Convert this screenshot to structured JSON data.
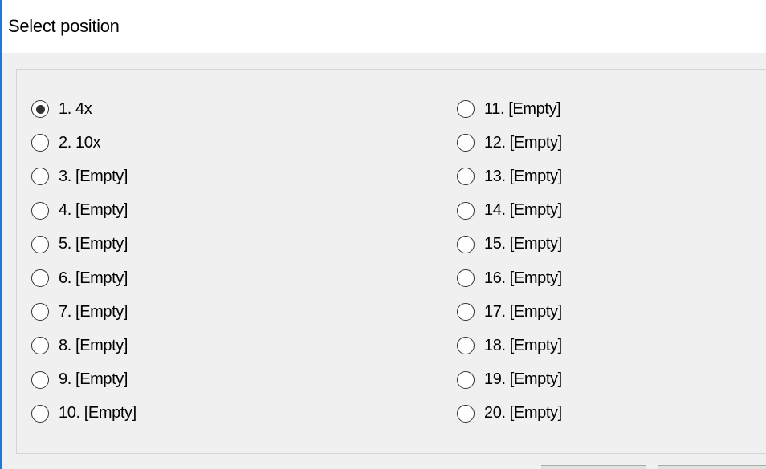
{
  "window": {
    "title": "Select position"
  },
  "positions": {
    "left": [
      {
        "label": "1. 4x",
        "checked": true
      },
      {
        "label": "2. 10x",
        "checked": false
      },
      {
        "label": "3. [Empty]",
        "checked": false
      },
      {
        "label": "4. [Empty]",
        "checked": false
      },
      {
        "label": "5. [Empty]",
        "checked": false
      },
      {
        "label": "6. [Empty]",
        "checked": false
      },
      {
        "label": "7. [Empty]",
        "checked": false
      },
      {
        "label": "8. [Empty]",
        "checked": false
      },
      {
        "label": "9. [Empty]",
        "checked": false
      },
      {
        "label": "10. [Empty]",
        "checked": false
      }
    ],
    "right": [
      {
        "label": "11. [Empty]",
        "checked": false
      },
      {
        "label": "12. [Empty]",
        "checked": false
      },
      {
        "label": "13. [Empty]",
        "checked": false
      },
      {
        "label": "14. [Empty]",
        "checked": false
      },
      {
        "label": "15. [Empty]",
        "checked": false
      },
      {
        "label": "16. [Empty]",
        "checked": false
      },
      {
        "label": "17. [Empty]",
        "checked": false
      },
      {
        "label": "18. [Empty]",
        "checked": false
      },
      {
        "label": "19. [Empty]",
        "checked": false
      },
      {
        "label": "20. [Empty]",
        "checked": false
      }
    ]
  },
  "colors": {
    "window_border": "#1e78d7",
    "dialog_background": "#f0f0f0",
    "titlebar_background": "#ffffff"
  }
}
